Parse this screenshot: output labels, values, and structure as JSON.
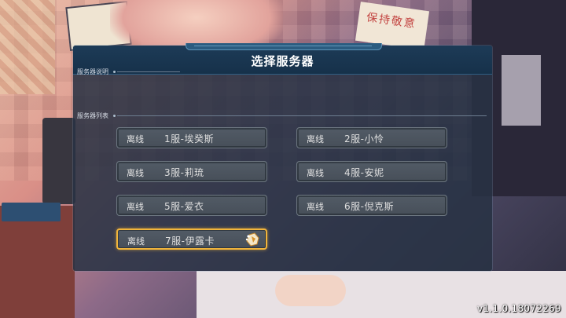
{
  "dialog": {
    "title": "选择服务器",
    "server_description_label": "服务器说明",
    "server_list_label": "服务器列表"
  },
  "background": {
    "sign_text": "保持敬意"
  },
  "servers": [
    {
      "status": "离线",
      "name": "1服-埃癸斯"
    },
    {
      "status": "离线",
      "name": "2服-小怜"
    },
    {
      "status": "离线",
      "name": "3服-莉琉"
    },
    {
      "status": "离线",
      "name": "4服-安妮"
    },
    {
      "status": "离线",
      "name": "5服-爱衣"
    },
    {
      "status": "离线",
      "name": "6服-倪克斯"
    },
    {
      "status": "离线",
      "name": "7服-伊露卡",
      "selected": true
    }
  ],
  "version": "v1.1.0.18072269",
  "colors": {
    "selected_border": "#f2b53b",
    "header_bg": "#1d3b57"
  },
  "icons": {
    "selection": "tap-cursor-icon"
  }
}
